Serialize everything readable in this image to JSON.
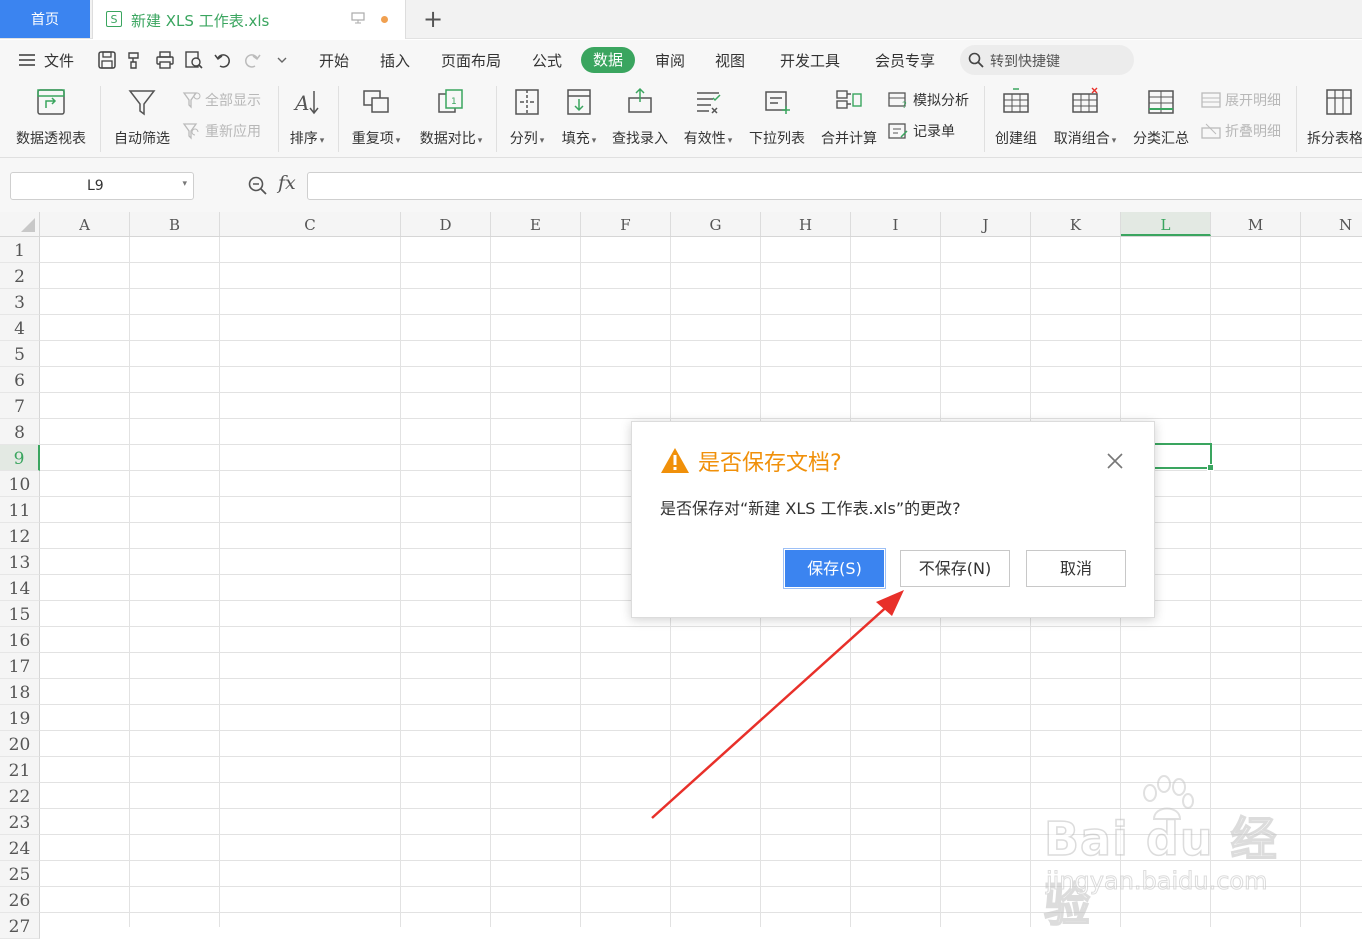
{
  "tabs": {
    "home": "首页",
    "doc_icon_letter": "S",
    "doc_title": "新建 XLS 工作表.xls",
    "new_tab": "+"
  },
  "menu": {
    "file": "文件",
    "items": [
      "开始",
      "插入",
      "页面布局",
      "公式",
      "数据",
      "审阅",
      "视图",
      "开发工具",
      "会员专享"
    ],
    "active": "数据",
    "search_placeholder": "转到快捷键"
  },
  "ribbon": {
    "pivot": "数据透视表",
    "autofilter": "自动筛选",
    "show_all": "全部显示",
    "reapply": "重新应用",
    "sort": "排序",
    "duplicates": "重复项",
    "compare": "数据对比",
    "split": "分列",
    "fill": "填充",
    "lookup": "查找录入",
    "validity": "有效性",
    "dropdown": "下拉列表",
    "consolidate": "合并计算",
    "whatif": "模拟分析",
    "record": "记录单",
    "group": "创建组",
    "ungroup": "取消组合",
    "subtotal": "分类汇总",
    "expand": "展开明细",
    "collapse": "折叠明细",
    "split_table": "拆分表格"
  },
  "formula_bar": {
    "name_box": "L9",
    "fx": "fx",
    "value": ""
  },
  "sheet": {
    "columns": [
      "A",
      "B",
      "C",
      "D",
      "E",
      "F",
      "G",
      "H",
      "I",
      "J",
      "K",
      "L",
      "M",
      "N"
    ],
    "rows": [
      "1",
      "2",
      "3",
      "4",
      "5",
      "6",
      "7",
      "8",
      "9",
      "10",
      "11",
      "12",
      "13",
      "14",
      "15",
      "16",
      "17",
      "18",
      "19",
      "20",
      "21",
      "22",
      "23",
      "24",
      "25",
      "26",
      "27"
    ],
    "selected_col": "L",
    "selected_row": "9"
  },
  "dialog": {
    "title": "是否保存文档?",
    "message": "是否保存对“新建 XLS 工作表.xls”的更改?",
    "save": "保存(S)",
    "dont_save": "不保存(N)",
    "cancel": "取消"
  },
  "watermark": {
    "brand": "Bai du 经验",
    "url": "jingyan.baidu.com"
  },
  "colors": {
    "accent_green": "#3aa55f",
    "primary_blue": "#3b84f0",
    "warning_orange": "#f0900a",
    "arrow_red": "#e8302a"
  }
}
